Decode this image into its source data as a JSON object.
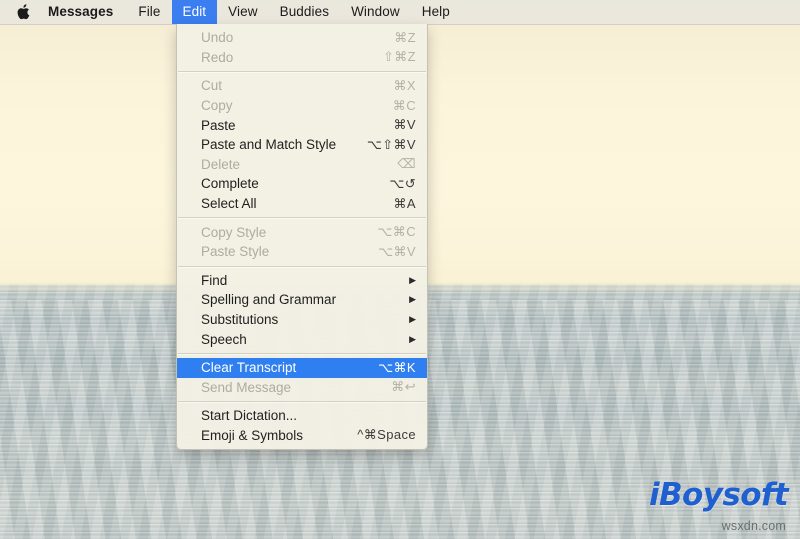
{
  "menubar": {
    "apple_icon": "apple-logo-icon",
    "items": [
      {
        "label": "Messages",
        "bold": true,
        "active": false
      },
      {
        "label": "File",
        "bold": false,
        "active": false
      },
      {
        "label": "Edit",
        "bold": false,
        "active": true
      },
      {
        "label": "View",
        "bold": false,
        "active": false
      },
      {
        "label": "Buddies",
        "bold": false,
        "active": false
      },
      {
        "label": "Window",
        "bold": false,
        "active": false
      },
      {
        "label": "Help",
        "bold": false,
        "active": false
      }
    ]
  },
  "edit_menu": {
    "title": "Edit",
    "groups": [
      {
        "items": [
          {
            "label": "Undo",
            "shortcut": "⌘Z",
            "enabled": false,
            "submenu": false,
            "selected": false
          },
          {
            "label": "Redo",
            "shortcut": "⇧⌘Z",
            "enabled": false,
            "submenu": false,
            "selected": false
          }
        ]
      },
      {
        "items": [
          {
            "label": "Cut",
            "shortcut": "⌘X",
            "enabled": false,
            "submenu": false,
            "selected": false
          },
          {
            "label": "Copy",
            "shortcut": "⌘C",
            "enabled": false,
            "submenu": false,
            "selected": false
          },
          {
            "label": "Paste",
            "shortcut": "⌘V",
            "enabled": true,
            "submenu": false,
            "selected": false
          },
          {
            "label": "Paste and Match Style",
            "shortcut": "⌥⇧⌘V",
            "enabled": true,
            "submenu": false,
            "selected": false
          },
          {
            "label": "Delete",
            "shortcut": "⌫",
            "enabled": false,
            "submenu": false,
            "selected": false
          },
          {
            "label": "Complete",
            "shortcut": "⌥↺",
            "enabled": true,
            "submenu": false,
            "selected": false
          },
          {
            "label": "Select All",
            "shortcut": "⌘A",
            "enabled": true,
            "submenu": false,
            "selected": false
          }
        ]
      },
      {
        "items": [
          {
            "label": "Copy Style",
            "shortcut": "⌥⌘C",
            "enabled": false,
            "submenu": false,
            "selected": false
          },
          {
            "label": "Paste Style",
            "shortcut": "⌥⌘V",
            "enabled": false,
            "submenu": false,
            "selected": false
          }
        ]
      },
      {
        "items": [
          {
            "label": "Find",
            "shortcut": "",
            "enabled": true,
            "submenu": true,
            "selected": false
          },
          {
            "label": "Spelling and Grammar",
            "shortcut": "",
            "enabled": true,
            "submenu": true,
            "selected": false
          },
          {
            "label": "Substitutions",
            "shortcut": "",
            "enabled": true,
            "submenu": true,
            "selected": false
          },
          {
            "label": "Speech",
            "shortcut": "",
            "enabled": true,
            "submenu": true,
            "selected": false
          }
        ]
      },
      {
        "items": [
          {
            "label": "Clear Transcript",
            "shortcut": "⌥⌘K",
            "enabled": true,
            "submenu": false,
            "selected": true
          },
          {
            "label": "Send Message",
            "shortcut": "⌘↩",
            "enabled": false,
            "submenu": false,
            "selected": false
          }
        ]
      },
      {
        "items": [
          {
            "label": "Start Dictation...",
            "shortcut": "",
            "enabled": true,
            "submenu": false,
            "selected": false
          },
          {
            "label": "Emoji & Symbols",
            "shortcut": "^⌘Space",
            "enabled": true,
            "submenu": false,
            "selected": false
          }
        ]
      }
    ]
  },
  "watermark": {
    "brand": "iBoysoft",
    "site": "wsxdn.com",
    "brand_color": "#1f5fd0"
  },
  "desktop": {
    "wallpaper_description": "ocean-horizon-wallpaper",
    "sky_color": "#fbf3d8",
    "sea_color": "#bcc5c2"
  }
}
